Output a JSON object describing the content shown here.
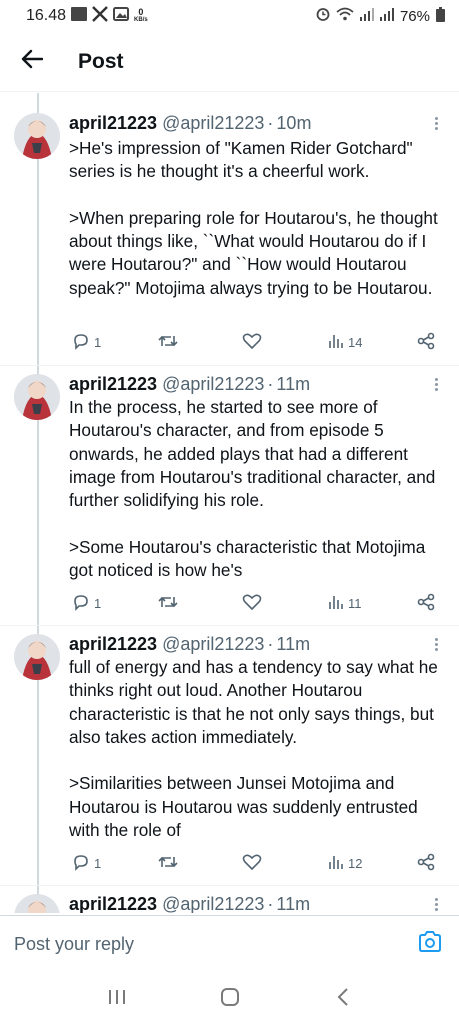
{
  "status_bar": {
    "time": "16.48",
    "net_speed_value": "0",
    "net_speed_unit": "KB/s",
    "battery": "76%",
    "icons": [
      "gallery-icon",
      "x-icon",
      "image-icon",
      "alarm-icon",
      "wifi-icon",
      "signal-icon",
      "signal-icon",
      "battery-icon"
    ]
  },
  "header": {
    "title": "Post",
    "back_icon": "arrow-left-icon"
  },
  "tweets": [
    {
      "name": "april21223",
      "handle": "@april21223",
      "separator": "·",
      "time": "10m",
      "paragraphs": [
        ">He's impression of \"Kamen Rider Gotchard\" series is he thought it's a cheerful work.",
        ">When preparing role for Houtarou's, he thought about things like, ``What would Houtarou do if I were Houtarou?\" and ``How would Houtarou speak?\" Motojima always trying to be Houtarou."
      ],
      "replies": "1",
      "retweets": "",
      "likes": "",
      "views": "14"
    },
    {
      "name": "april21223",
      "handle": "@april21223",
      "separator": "·",
      "time": "11m",
      "paragraphs": [
        "In the process, he started to see more of Houtarou's character, and from episode 5 onwards, he added plays that had a different image from Houtarou's traditional character, and further solidifying his role.",
        ">Some Houtarou's characteristic that Motojima got noticed is how he's"
      ],
      "replies": "1",
      "retweets": "",
      "likes": "",
      "views": "11"
    },
    {
      "name": "april21223",
      "handle": "@april21223",
      "separator": "·",
      "time": "11m",
      "paragraphs": [
        "full of energy and has a tendency to say what he thinks right out loud. Another Houtarou characteristic is that he not only says things, but also takes action immediately.",
        ">Similarities between Junsei Motojima and Houtarou is Houtarou was suddenly entrusted with the role of"
      ],
      "replies": "1",
      "retweets": "",
      "likes": "",
      "views": "12"
    },
    {
      "name": "april21223",
      "handle": "@april21223",
      "separator": "·",
      "time": "11m"
    }
  ],
  "reply_bar": {
    "placeholder": "Post your reply",
    "camera_icon": "camera-icon"
  },
  "nav_bar": {
    "icons": [
      "recent-apps-icon",
      "home-icon",
      "back-icon"
    ]
  },
  "colors": {
    "text": "#0f1419",
    "secondary": "#536471",
    "accent": "#1d9bf0",
    "thread_line": "#cfd9de"
  }
}
